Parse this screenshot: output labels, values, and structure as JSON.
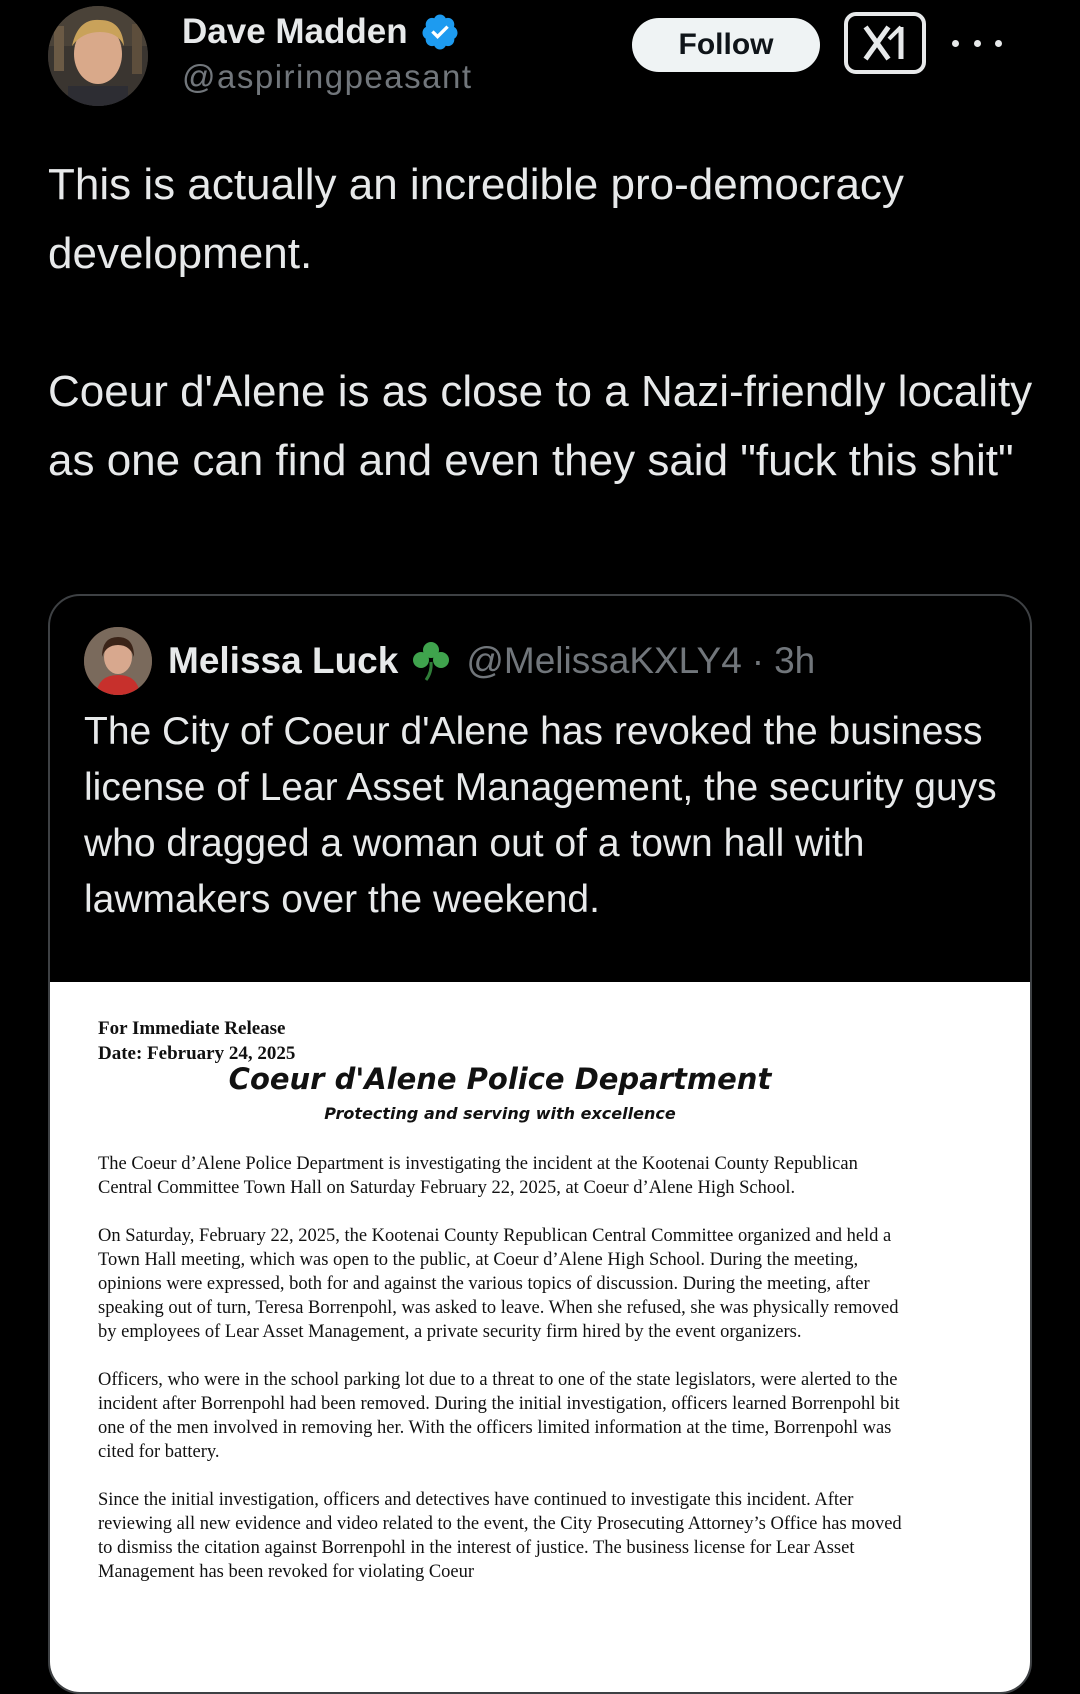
{
  "post": {
    "author_name": "Dave Madden",
    "author_handle": "@aspiringpeasant",
    "follow_label": "Follow",
    "verified_icon": "verified-badge-icon",
    "grok_icon": "grok-icon",
    "more_icon": "more-options-icon",
    "paragraphs": [
      "This is actually an incredible pro-democracy development.",
      "Coeur d'Alene is as close to a Nazi-friendly locality as one can find and even they said \"fuck this shit\""
    ]
  },
  "quote": {
    "author_name": "Melissa Luck",
    "emoji": "shamrock-icon",
    "handle": "@MelissaKXLY4",
    "separator": "·",
    "time": "3h",
    "text": "The City of Coeur d'Alene has revoked the business license of Lear Asset Management, the security guys who dragged a woman out of a town hall with lawmakers over the weekend."
  },
  "press_release": {
    "release_line": "For Immediate Release",
    "date_line": "Date:  February 24, 2025",
    "title": "Coeur d'Alene Police Department",
    "subtitle": "Protecting and serving with excellence",
    "paragraphs": [
      "The Coeur d’Alene Police Department is investigating the incident at the Kootenai County Republican Central Committee Town Hall on Saturday February 22, 2025, at Coeur d’Alene High School.",
      "On Saturday, February 22, 2025, the Kootenai County Republican Central Committee organized and held a Town Hall meeting, which was open to the public, at Coeur d’Alene High School.  During the meeting, opinions were expressed, both for and against the various topics of discussion.  During the meeting, after speaking out of turn, Teresa Borrenpohl, was asked to leave.  When she refused, she was physically removed by employees of Lear Asset Management, a private security firm hired by the event organizers.",
      "Officers, who were in the school parking lot due to a threat to one of the state legislators, were alerted to the incident after Borrenpohl had been removed.  During the initial investigation, officers learned Borrenpohl bit one of the men involved in removing her.  With the officers limited information at the time, Borrenpohl was cited for battery.",
      "Since the initial investigation, officers and detectives have continued to investigate this incident.  After reviewing all new evidence and video related to the event, the City Prosecuting Attorney’s Office has moved to dismiss the citation against Borrenpohl in the interest of justice.  The business license for Lear Asset Management has been revoked for violating Coeur"
    ]
  },
  "colors": {
    "background": "#000000",
    "text_primary": "#e7e9ea",
    "text_secondary": "#71767b",
    "verified_blue": "#1d9bf0",
    "border": "#3e4144"
  }
}
